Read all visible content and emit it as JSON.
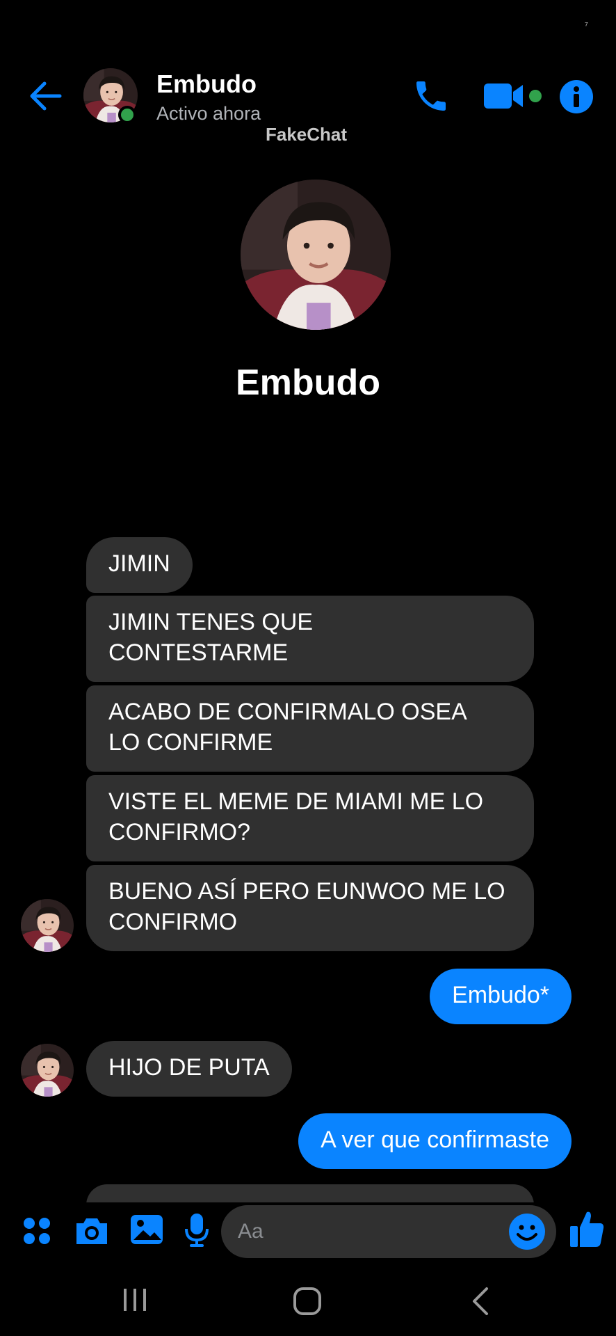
{
  "status": {
    "glyph": "⁷"
  },
  "header": {
    "name": "Embudo",
    "status": "Activo ahora",
    "watermark": "FakeChat"
  },
  "profile": {
    "name": "Embudo"
  },
  "messages": [
    {
      "side": "in",
      "text": "JIMIN"
    },
    {
      "side": "in",
      "lines": [
        "JIMIN TENES QUE",
        "CONTESTARME"
      ]
    },
    {
      "side": "in",
      "lines": [
        "ACABO DE CONFIRMALO OSEA",
        "LO CONFIRME"
      ]
    },
    {
      "side": "in",
      "lines": [
        "VISTE EL MEME DE MIAMI ME LO",
        "CONFIRMO?"
      ]
    },
    {
      "side": "in",
      "lines": [
        "BUENO ASÍ PERO EUNWOO ME LO",
        "CONFIRMO"
      ]
    },
    {
      "side": "out",
      "text": "Embudo*"
    },
    {
      "side": "in",
      "text": "HIJO DE PUTA"
    },
    {
      "side": "out",
      "text": "A ver que confirmaste"
    }
  ],
  "composer": {
    "placeholder": "Aa"
  },
  "colors": {
    "accent": "#0a84ff",
    "incoming_bubble": "#303030",
    "online": "#31a24c",
    "background": "#000000"
  },
  "icons": [
    "back-arrow-icon",
    "phone-icon",
    "video-camera-icon",
    "info-icon",
    "menu-dots-icon",
    "camera-icon",
    "gallery-icon",
    "microphone-icon",
    "emoji-icon",
    "thumbs-up-icon",
    "recents-icon",
    "home-icon",
    "nav-back-icon"
  ]
}
